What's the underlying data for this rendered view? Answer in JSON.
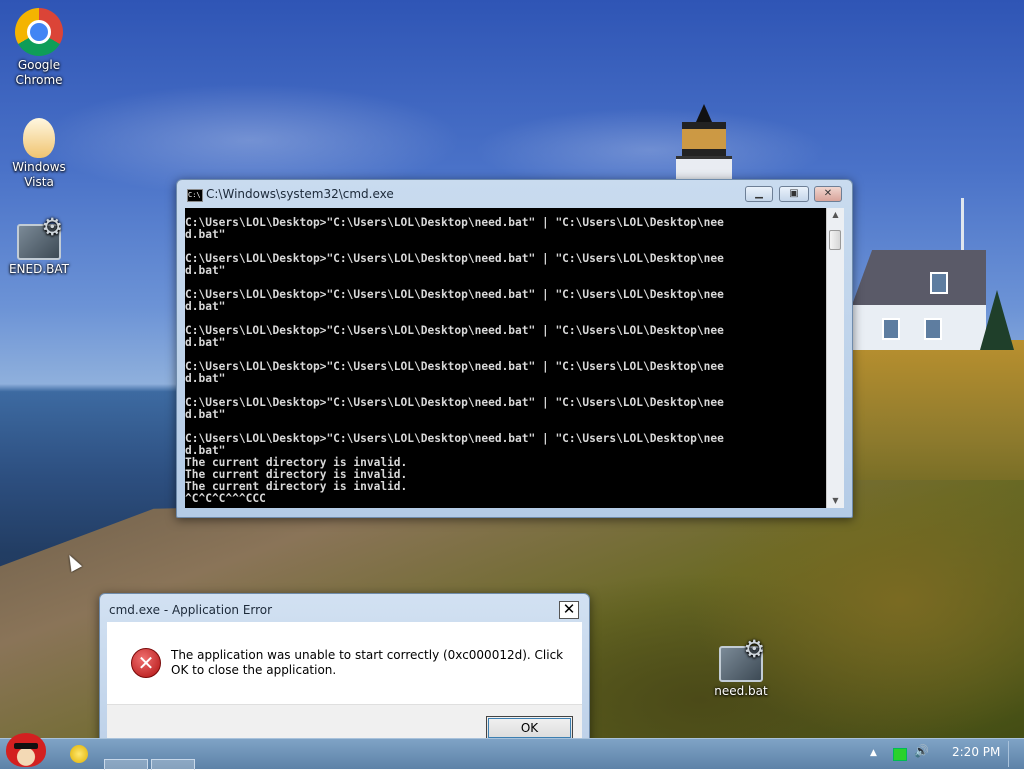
{
  "desktop": {
    "icons": [
      {
        "label": "Google Chrome",
        "icon": "chrome-icon"
      },
      {
        "label": "Windows Vista",
        "icon": "egg-icon"
      },
      {
        "label": "ENED.BAT",
        "icon": "batch-file-icon"
      },
      {
        "label": "need.bat",
        "icon": "batch-file-icon"
      }
    ]
  },
  "cmd_window": {
    "title": "C:\\Windows\\system32\\cmd.exe",
    "minimize": "▁",
    "maximize": "▣",
    "close": "✕",
    "console_text": "C:\\Users\\LOL\\Desktop>\"C:\\Users\\LOL\\Desktop\\need.bat\" | \"C:\\Users\\LOL\\Desktop\\nee\nd.bat\"\n\nC:\\Users\\LOL\\Desktop>\"C:\\Users\\LOL\\Desktop\\need.bat\" | \"C:\\Users\\LOL\\Desktop\\nee\nd.bat\"\n\nC:\\Users\\LOL\\Desktop>\"C:\\Users\\LOL\\Desktop\\need.bat\" | \"C:\\Users\\LOL\\Desktop\\nee\nd.bat\"\n\nC:\\Users\\LOL\\Desktop>\"C:\\Users\\LOL\\Desktop\\need.bat\" | \"C:\\Users\\LOL\\Desktop\\nee\nd.bat\"\n\nC:\\Users\\LOL\\Desktop>\"C:\\Users\\LOL\\Desktop\\need.bat\" | \"C:\\Users\\LOL\\Desktop\\nee\nd.bat\"\n\nC:\\Users\\LOL\\Desktop>\"C:\\Users\\LOL\\Desktop\\need.bat\" | \"C:\\Users\\LOL\\Desktop\\nee\nd.bat\"\n\nC:\\Users\\LOL\\Desktop>\"C:\\Users\\LOL\\Desktop\\need.bat\" | \"C:\\Users\\LOL\\Desktop\\nee\nd.bat\"\nThe current directory is invalid.\nThe current directory is invalid.\nThe current directory is invalid.\n^C^C^C^^^CCC",
    "scroll_up": "▲",
    "scroll_down": "▼"
  },
  "error_dialog": {
    "title": "cmd.exe - Application Error",
    "close": "✕",
    "icon": "error-icon",
    "icon_glyph": "✕",
    "message": "The application was unable to start correctly (0xc000012d). Click OK to close the application.",
    "ok_label": "OK"
  },
  "taskbar": {
    "start_icon": "angry-bird-icon",
    "clock": "2:20 PM",
    "tray_up_arrow": "▲",
    "volume_glyph": "🔊"
  }
}
